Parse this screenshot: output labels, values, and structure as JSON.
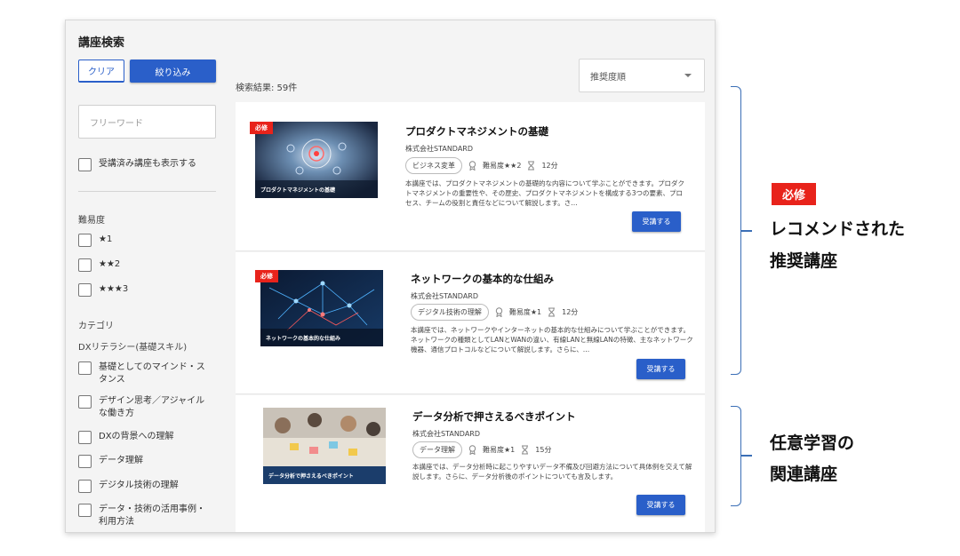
{
  "sidebar": {
    "title": "講座検索",
    "clear_label": "クリア",
    "filter_label": "絞り込み",
    "free_word_placeholder": "フリーワード",
    "show_completed_label": "受講済み講座も表示する",
    "difficulty_heading": "難易度",
    "difficulty_options": [
      "★1",
      "★★2",
      "★★★3"
    ],
    "category_heading": "カテゴリ",
    "category_group": "DXリテラシー(基礎スキル)",
    "category_options": [
      "基礎としてのマインド・スタンス",
      "デザイン思考／アジャイルな働き方",
      "DXの背景への理解",
      "データ理解",
      "デジタル技術の理解",
      "データ・技術の活用事例・利用方法"
    ]
  },
  "results": {
    "count_label": "検索結果: 59件",
    "sort_value": "推奨度順"
  },
  "courses": [
    {
      "required_tag": "必修",
      "thumb_caption": "プロダクトマネジメントの基礎",
      "title": "プロダクトマネジメントの基礎",
      "company": "株式会社STANDARD",
      "category": "ビジネス変革",
      "difficulty": "難易度★★2",
      "duration": "12分",
      "description": "本講座では、プロダクトマネジメントの基礎的な内容について学ぶことができます。プロダクトマネジメントの重要性や、その歴史、プロダクトマネジメントを構成する3つの要素、プロセス、チームの役割と責任などについて解説します。さ…",
      "button_label": "受講する"
    },
    {
      "required_tag": "必修",
      "thumb_caption": "ネットワークの基本的な仕組み",
      "title": "ネットワークの基本的な仕組み",
      "company": "株式会社STANDARD",
      "category": "デジタル技術の理解",
      "difficulty": "難易度★1",
      "duration": "12分",
      "description": "本講座では、ネットワークやインターネットの基本的な仕組みについて学ぶことができます。ネットワークの種類としてLANとWANの違い、有線LANと無線LANの特徴、主なネットワーク機器、通信プロトコルなどについて解説します。さらに、…",
      "button_label": "受講する"
    },
    {
      "required_tag": "",
      "thumb_caption": "データ分析で押さえるべきポイント",
      "title": "データ分析で押さえるべきポイント",
      "company": "株式会社STANDARD",
      "category": "データ理解",
      "difficulty": "難易度★1",
      "duration": "15分",
      "description": "本講座では、データ分析時に起こりやすいデータ不備及び回避方法について具体例を交えて解説します。さらに、データ分析後のポイントについても言及します。",
      "button_label": "受講する"
    }
  ],
  "annotations": {
    "recommended_tag": "必修",
    "recommended_line1": "レコメンドされた",
    "recommended_line2": "推奨講座",
    "optional_line1": "任意学習の",
    "optional_line2": "関連講座"
  },
  "colors": {
    "primary_blue": "#2a5fc9",
    "required_red": "#e8231b",
    "bracket_blue": "#3b6fb6"
  }
}
